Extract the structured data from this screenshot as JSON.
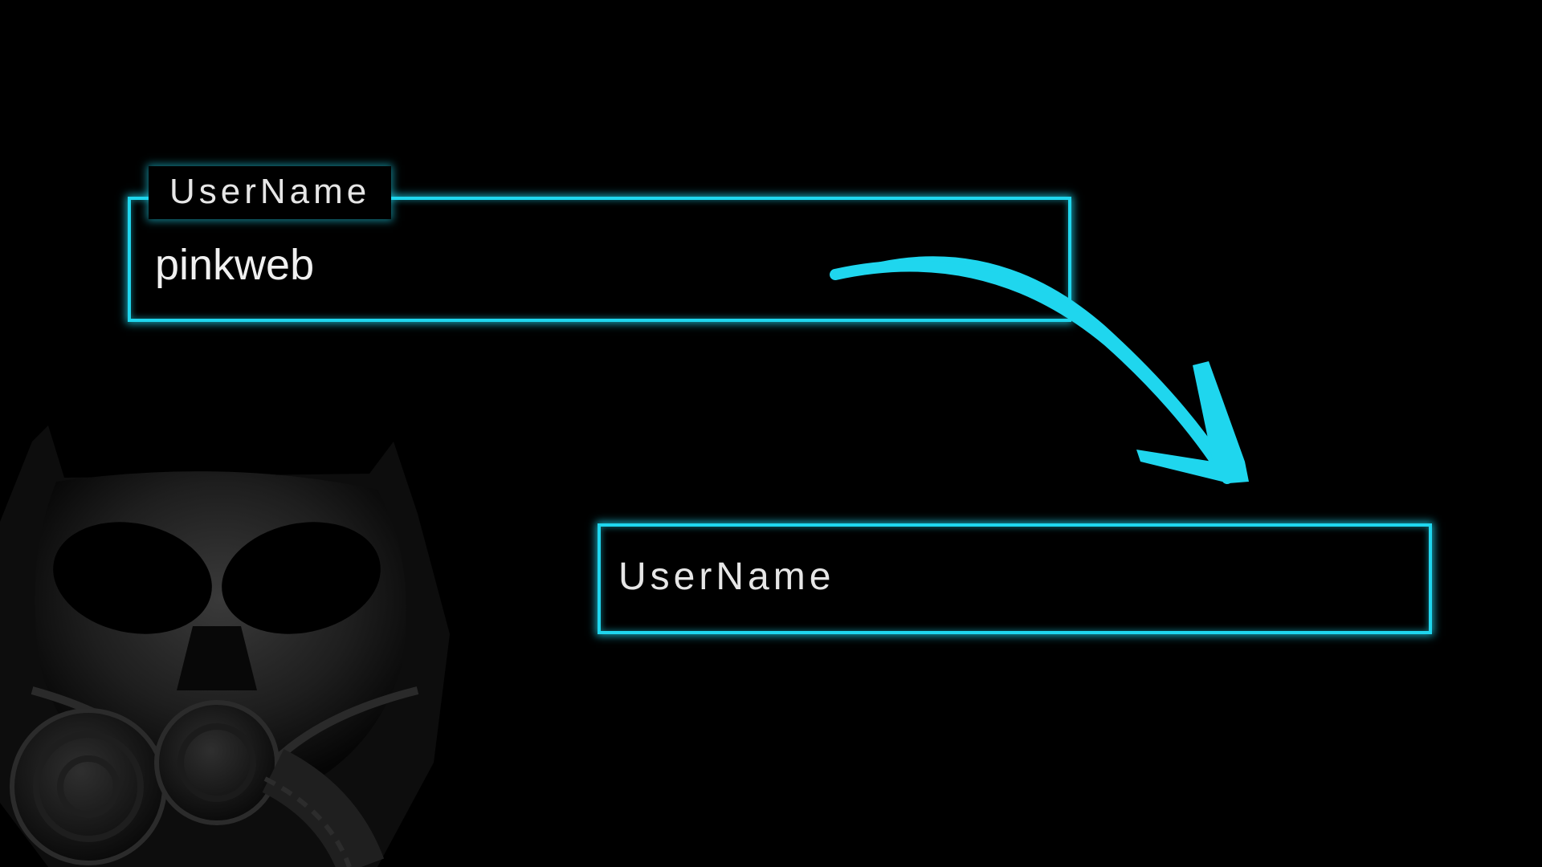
{
  "filled_field": {
    "label": "UserName",
    "value": "pinkweb"
  },
  "empty_field": {
    "label": "UserName"
  },
  "arrow": {
    "icon": "curved-arrow-icon",
    "color": "#1fd6ee"
  },
  "decoration": {
    "icon": "gas-mask-icon"
  },
  "colors": {
    "background": "#000000",
    "accent": "#1fd6ee",
    "text": "#e6e6e6"
  }
}
